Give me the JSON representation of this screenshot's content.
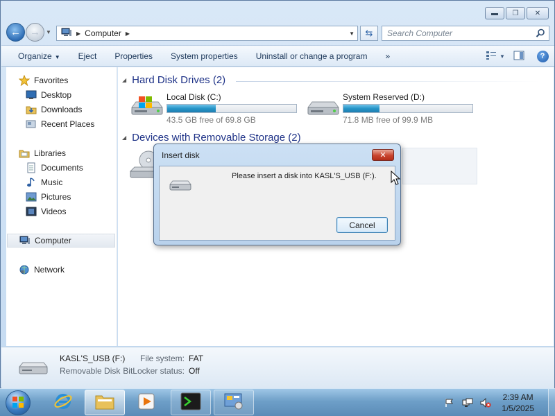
{
  "window": {
    "controls": {
      "minimize": "minimize-icon",
      "maximize": "maximize-icon",
      "close": "close-icon"
    }
  },
  "address_bar": {
    "crumb": "Computer",
    "search_placeholder": "Search Computer"
  },
  "toolbar": {
    "organize": "Organize",
    "eject": "Eject",
    "properties": "Properties",
    "system_properties": "System properties",
    "uninstall": "Uninstall or change a program",
    "more": "»"
  },
  "sidebar": {
    "favorites": "Favorites",
    "desktop": "Desktop",
    "downloads": "Downloads",
    "recent_places": "Recent Places",
    "libraries": "Libraries",
    "documents": "Documents",
    "music": "Music",
    "pictures": "Pictures",
    "videos": "Videos",
    "computer": "Computer",
    "network": "Network"
  },
  "content": {
    "hard_disk_header": "Hard Disk Drives (2)",
    "removable_header": "Devices with Removable Storage (2)",
    "drives": [
      {
        "name": "Local Disk (C:)",
        "free": "43.5 GB free of 69.8 GB",
        "used_fraction": 0.377
      },
      {
        "name": "System Reserved (D:)",
        "free": "71.8 MB free of 99.9 MB",
        "used_fraction": 0.281
      }
    ]
  },
  "details": {
    "name": "KASL'S_USB (F:)",
    "type": "Removable Disk",
    "fs_label": "File system:",
    "fs_value": "FAT",
    "bitlocker_label": "BitLocker status:",
    "bitlocker_value": "Off"
  },
  "dialog": {
    "title": "Insert disk",
    "message": "Please insert a disk into KASL'S_USB (F:).",
    "cancel": "Cancel"
  },
  "taskbar": {
    "time": "2:39 AM",
    "date": "1/5/2025"
  },
  "colors": {
    "accent": "#1e3287",
    "bar_fill": "#2695c8",
    "close_red": "#c9452f"
  }
}
